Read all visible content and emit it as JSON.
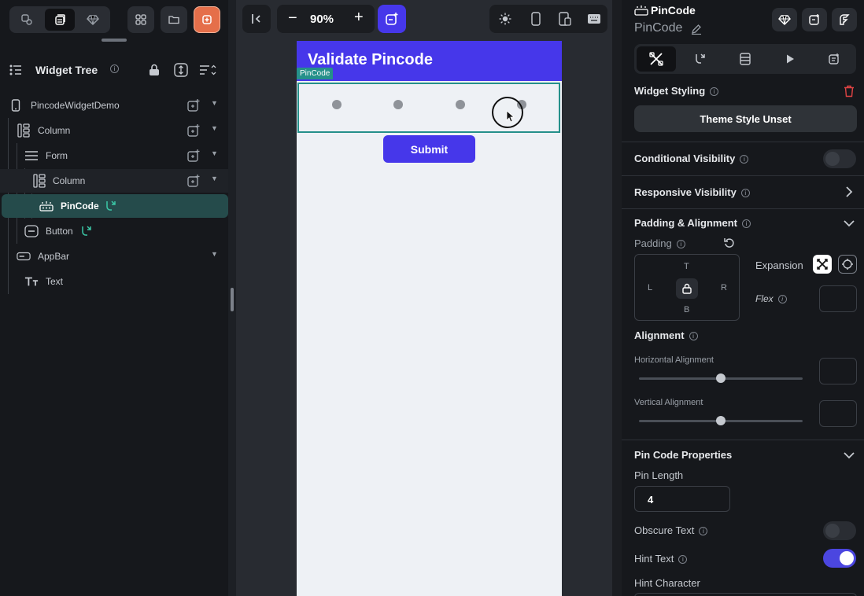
{
  "left_panel": {
    "widget_tree_title": "Widget Tree",
    "tree": [
      {
        "label": "PincodeWidgetDemo"
      },
      {
        "label": "Column"
      },
      {
        "label": "Form"
      },
      {
        "label": "Column"
      },
      {
        "label": "PinCode"
      },
      {
        "label": "Button"
      },
      {
        "label": "AppBar"
      },
      {
        "label": "Text"
      }
    ]
  },
  "canvas": {
    "zoom": "90%",
    "appbar_title": "Validate Pincode",
    "selected_tag": "PinCode",
    "pin_dots": 4,
    "submit_label": "Submit"
  },
  "right_panel": {
    "widget_type": "PinCode",
    "widget_name": "PinCode",
    "widget_styling_label": "Widget Styling",
    "theme_button_label": "Theme Style Unset",
    "conditional_visibility_label": "Conditional Visibility",
    "conditional_visibility_on": false,
    "responsive_visibility_label": "Responsive Visibility",
    "padding_alignment_label": "Padding & Alignment",
    "padding_label": "Padding",
    "pad_top": "T",
    "pad_bottom": "B",
    "pad_left": "L",
    "pad_right": "R",
    "expansion_label": "Expansion",
    "flex_label": "Flex",
    "alignment_label": "Alignment",
    "horizontal_alignment_label": "Horizontal Alignment",
    "horizontal_alignment_value": 0.5,
    "vertical_alignment_label": "Vertical Alignment",
    "vertical_alignment_value": 0.5,
    "pin_code_properties_label": "Pin Code Properties",
    "pin_length_label": "Pin Length",
    "pin_length_value": "4",
    "obscure_text_label": "Obscure Text",
    "obscure_text_on": false,
    "hint_text_label": "Hint Text",
    "hint_text_on": true,
    "hint_character_label": "Hint Character"
  },
  "colors": {
    "accent": "#4637ea",
    "selection": "#25908a",
    "toggle_on": "#4b46e0",
    "delete_icon": "#e04444",
    "orange_button": "#e56f4a"
  }
}
